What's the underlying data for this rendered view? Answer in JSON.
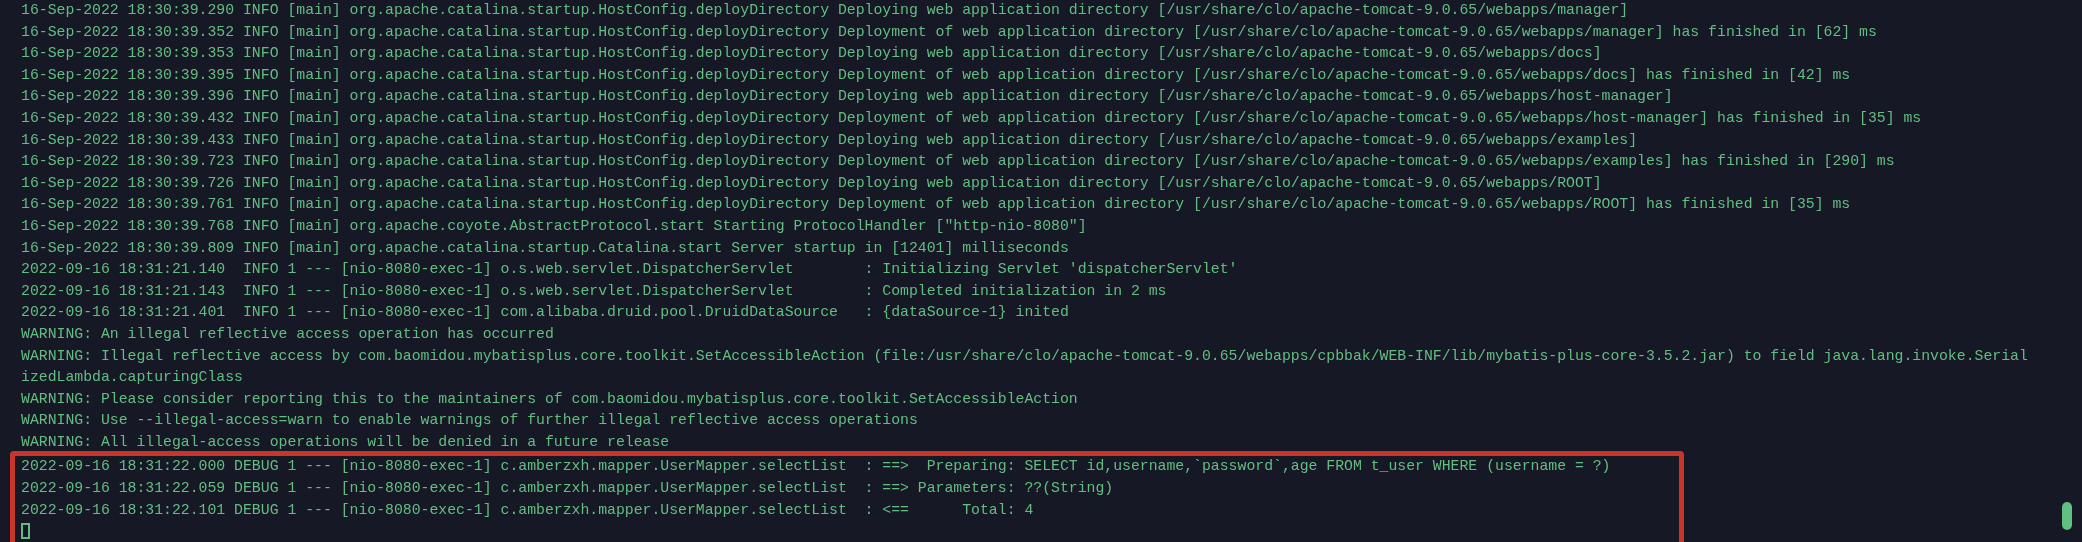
{
  "terminal": {
    "lines": [
      "16-Sep-2022 18:30:39.290 INFO [main] org.apache.catalina.startup.HostConfig.deployDirectory Deploying web application directory [/usr/share/clo/apache-tomcat-9.0.65/webapps/manager]",
      "16-Sep-2022 18:30:39.352 INFO [main] org.apache.catalina.startup.HostConfig.deployDirectory Deployment of web application directory [/usr/share/clo/apache-tomcat-9.0.65/webapps/manager] has finished in [62] ms",
      "16-Sep-2022 18:30:39.353 INFO [main] org.apache.catalina.startup.HostConfig.deployDirectory Deploying web application directory [/usr/share/clo/apache-tomcat-9.0.65/webapps/docs]",
      "16-Sep-2022 18:30:39.395 INFO [main] org.apache.catalina.startup.HostConfig.deployDirectory Deployment of web application directory [/usr/share/clo/apache-tomcat-9.0.65/webapps/docs] has finished in [42] ms",
      "16-Sep-2022 18:30:39.396 INFO [main] org.apache.catalina.startup.HostConfig.deployDirectory Deploying web application directory [/usr/share/clo/apache-tomcat-9.0.65/webapps/host-manager]",
      "16-Sep-2022 18:30:39.432 INFO [main] org.apache.catalina.startup.HostConfig.deployDirectory Deployment of web application directory [/usr/share/clo/apache-tomcat-9.0.65/webapps/host-manager] has finished in [35] ms",
      "16-Sep-2022 18:30:39.433 INFO [main] org.apache.catalina.startup.HostConfig.deployDirectory Deploying web application directory [/usr/share/clo/apache-tomcat-9.0.65/webapps/examples]",
      "16-Sep-2022 18:30:39.723 INFO [main] org.apache.catalina.startup.HostConfig.deployDirectory Deployment of web application directory [/usr/share/clo/apache-tomcat-9.0.65/webapps/examples] has finished in [290] ms",
      "16-Sep-2022 18:30:39.726 INFO [main] org.apache.catalina.startup.HostConfig.deployDirectory Deploying web application directory [/usr/share/clo/apache-tomcat-9.0.65/webapps/ROOT]",
      "16-Sep-2022 18:30:39.761 INFO [main] org.apache.catalina.startup.HostConfig.deployDirectory Deployment of web application directory [/usr/share/clo/apache-tomcat-9.0.65/webapps/ROOT] has finished in [35] ms",
      "16-Sep-2022 18:30:39.768 INFO [main] org.apache.coyote.AbstractProtocol.start Starting ProtocolHandler [\"http-nio-8080\"]",
      "16-Sep-2022 18:30:39.809 INFO [main] org.apache.catalina.startup.Catalina.start Server startup in [12401] milliseconds",
      "2022-09-16 18:31:21.140  INFO 1 --- [nio-8080-exec-1] o.s.web.servlet.DispatcherServlet        : Initializing Servlet 'dispatcherServlet'",
      "2022-09-16 18:31:21.143  INFO 1 --- [nio-8080-exec-1] o.s.web.servlet.DispatcherServlet        : Completed initialization in 2 ms",
      "2022-09-16 18:31:21.401  INFO 1 --- [nio-8080-exec-1] com.alibaba.druid.pool.DruidDataSource   : {dataSource-1} inited",
      "WARNING: An illegal reflective access operation has occurred",
      "WARNING: Illegal reflective access by com.baomidou.mybatisplus.core.toolkit.SetAccessibleAction (file:/usr/share/clo/apache-tomcat-9.0.65/webapps/cpbbak/WEB-INF/lib/mybatis-plus-core-3.5.2.jar) to field java.lang.invoke.Serial",
      "izedLambda.capturingClass",
      "WARNING: Please consider reporting this to the maintainers of com.baomidou.mybatisplus.core.toolkit.SetAccessibleAction",
      "WARNING: Use --illegal-access=warn to enable warnings of further illegal reflective access operations",
      "WARNING: All illegal-access operations will be denied in a future release"
    ],
    "highlighted_lines": [
      "2022-09-16 18:31:22.000 DEBUG 1 --- [nio-8080-exec-1] c.amberzxh.mapper.UserMapper.selectList  : ==>  Preparing: SELECT id,username,`password`,age FROM t_user WHERE (username = ?)",
      "2022-09-16 18:31:22.059 DEBUG 1 --- [nio-8080-exec-1] c.amberzxh.mapper.UserMapper.selectList  : ==> Parameters: ??(String)",
      "2022-09-16 18:31:22.101 DEBUG 1 --- [nio-8080-exec-1] c.amberzxh.mapper.UserMapper.selectList  : <==      Total: 4"
    ]
  }
}
